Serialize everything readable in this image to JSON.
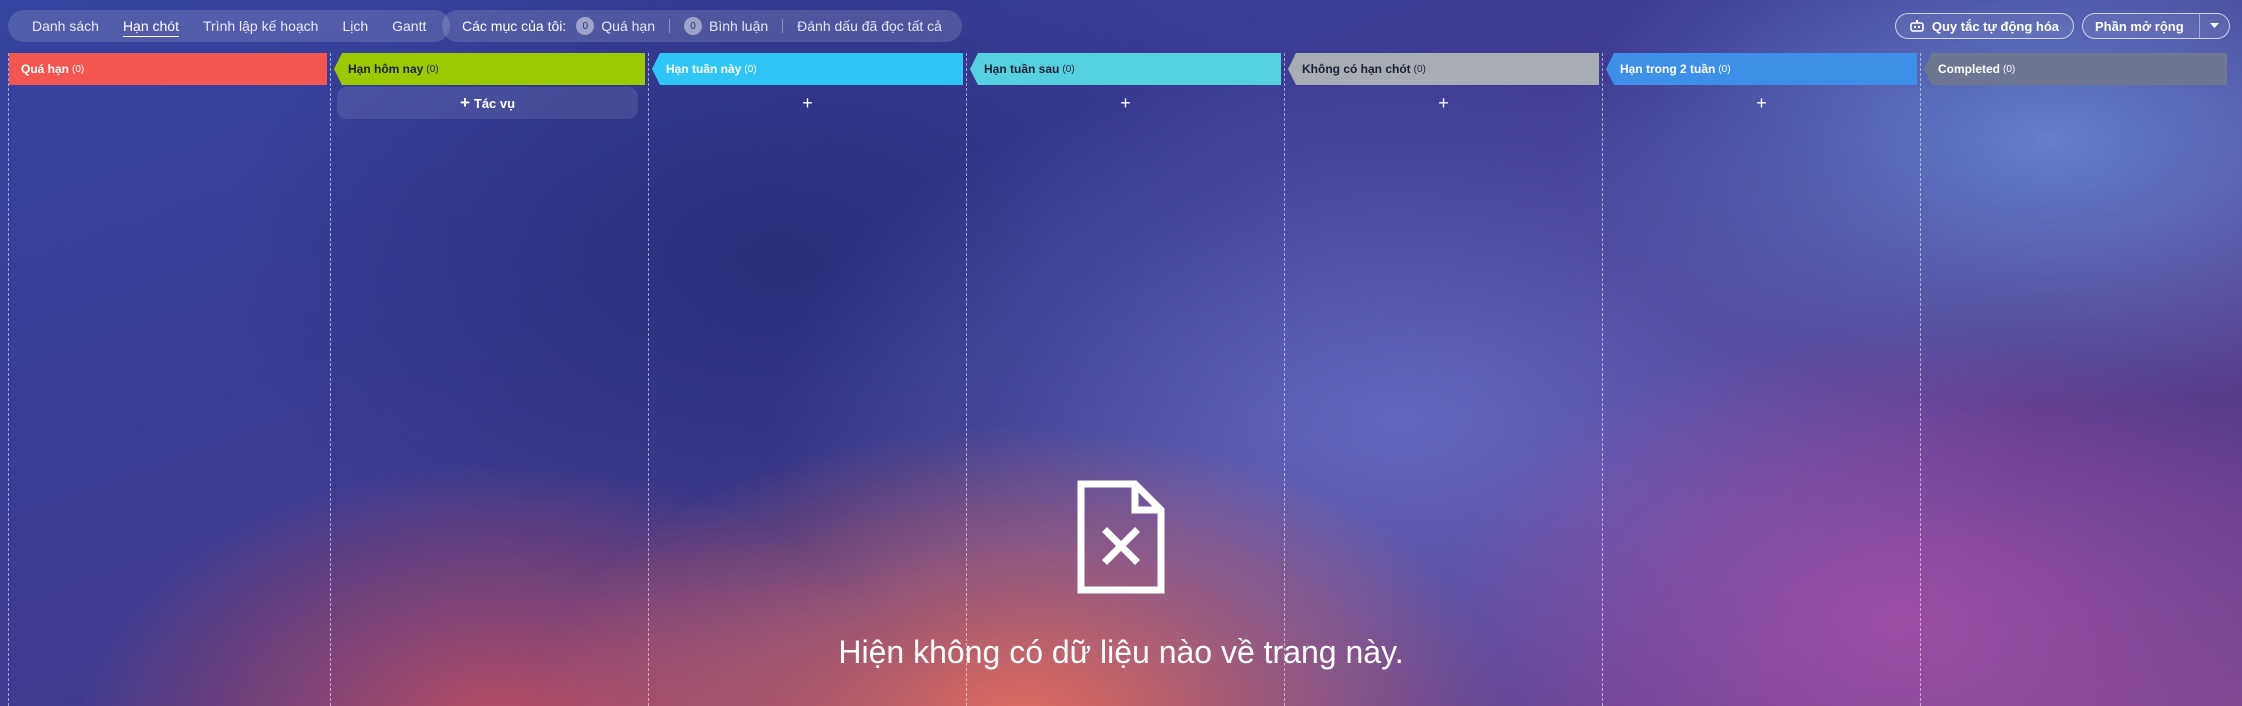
{
  "nav": {
    "tabs": [
      {
        "label": "Danh sách",
        "active": false
      },
      {
        "label": "Hạn chót",
        "active": true
      },
      {
        "label": "Trình lập kế hoạch",
        "active": false
      },
      {
        "label": "Lịch",
        "active": false
      },
      {
        "label": "Gantt",
        "active": false
      }
    ]
  },
  "my_items": {
    "label": "Các mục của tôi:",
    "overdue": {
      "count": "0",
      "label": "Quá hạn"
    },
    "comments": {
      "count": "0",
      "label": "Bình luận"
    },
    "mark_all_read": "Đánh dấu đã đọc tất cả"
  },
  "actions": {
    "automation_rules": "Quy tắc tự động hóa",
    "extensions": "Phần mở rộng"
  },
  "columns": [
    {
      "title": "Quá hạn",
      "count": "(0)",
      "color": "#f3564f"
    },
    {
      "title": "Hạn hôm nay",
      "count": "(0)",
      "color": "#9cc900"
    },
    {
      "title": "Hạn tuần này",
      "count": "(0)",
      "color": "#2fc6f6"
    },
    {
      "title": "Hạn tuần sau",
      "count": "(0)",
      "color": "#55d0e0"
    },
    {
      "title": "Không có hạn chót",
      "count": "(0)",
      "color": "#a8adb4"
    },
    {
      "title": "Hạn trong 2 tuần",
      "count": "(0)",
      "color": "#3e8fe8"
    },
    {
      "title": "Completed",
      "count": "(0)",
      "color": "#6f7691"
    }
  ],
  "add_task_label": "Tác vụ",
  "add_symbol": "+",
  "empty_state": {
    "icon": "file-x-icon",
    "message": "Hiện không có dữ liệu nào về trang này."
  }
}
